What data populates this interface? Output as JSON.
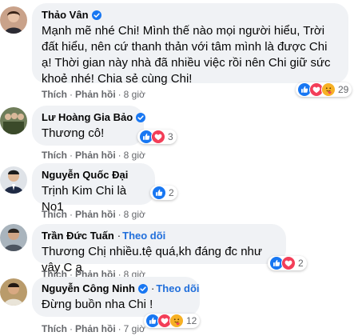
{
  "comments": [
    {
      "author": "Thảo Vân",
      "verified": true,
      "text": "Mạnh mẽ nhé Chi! Mình thế nào mọi người hiểu, Trời đất hiểu, nên cứ thanh thản với tâm mình là được Chi ạ! Thời gian này nhà đã nhiều việc rồi nên Chi giữ sức khoẻ nhé! Chia sẻ cùng Chi!",
      "like_label": "Thích",
      "reply_label": "Phản hồi",
      "time": "8 giờ",
      "reaction_icons": [
        "like-icon",
        "love-icon",
        "care-icon"
      ],
      "reaction_count": "29"
    },
    {
      "author": "Lư Hoàng Gia Bảo",
      "verified": true,
      "text": "Thương cô!",
      "like_label": "Thích",
      "reply_label": "Phản hồi",
      "time": "8 giờ",
      "reaction_icons": [
        "like-icon",
        "love-icon"
      ],
      "reaction_count": "3"
    },
    {
      "author": "Nguyễn Quốc Đại",
      "verified": false,
      "text": "Trịnh Kim Chi là No1",
      "like_label": "Thích",
      "reply_label": "Phản hồi",
      "time": "8 giờ",
      "reaction_icons": [
        "like-icon"
      ],
      "reaction_count": "2"
    },
    {
      "author": "Trần Đức Tuấn",
      "verified": false,
      "follow_label": "Theo dõi",
      "text": "Thương Chị nhiều.tệ quá,kh đáng đc như vậy C ạ",
      "like_label": "Thích",
      "reply_label": "Phản hồi",
      "time": "8 giờ",
      "reaction_icons": [
        "like-icon",
        "love-icon"
      ],
      "reaction_count": "2"
    },
    {
      "author": "Nguyễn Công Ninh",
      "verified": true,
      "follow_label": "Theo dõi",
      "text": "Đừng buồn nha Chi !",
      "like_label": "Thích",
      "reply_label": "Phản hồi",
      "time": "7 giờ",
      "reaction_icons": [
        "like-icon",
        "love-icon",
        "care-icon"
      ],
      "reaction_count": "12"
    }
  ],
  "colors": {
    "bubble": "#f0f2f5",
    "link": "#216fdb",
    "like": "#1877f2",
    "love": "#f33e58",
    "care": "#f7b125",
    "meta": "#65676b"
  }
}
